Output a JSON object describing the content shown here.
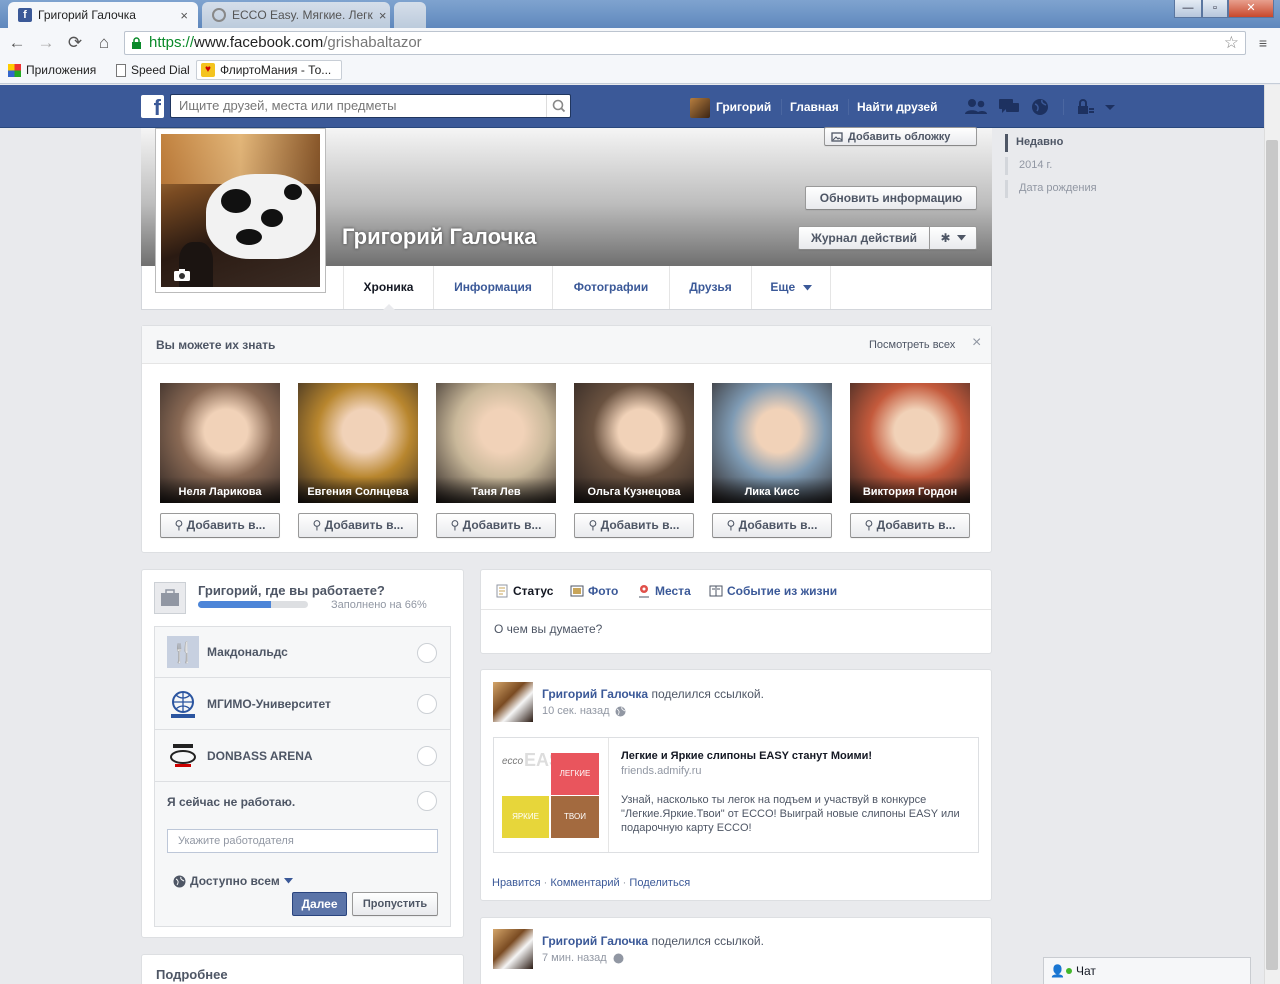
{
  "browser": {
    "tabs": [
      {
        "title": "Григорий Галочка",
        "close": "×"
      },
      {
        "title": "ECCO Easy. Мягкие. Легк",
        "close": "×"
      }
    ],
    "window_buttons": {
      "min": "—",
      "max": "▫",
      "close": "✕"
    },
    "url": {
      "scheme": "https://",
      "host": "www.facebook.com",
      "path": "/grishabaltazor"
    },
    "star": "☆",
    "bookmarks": [
      "Приложения",
      "Speed Dial",
      "ФлиртоМания - То..."
    ]
  },
  "fb": {
    "logo": "f",
    "search_placeholder": "Ищите друзей, места или предметы",
    "nav": {
      "user": "Григорий",
      "home": "Главная",
      "find": "Найти друзей"
    }
  },
  "profile": {
    "name": "Григорий Галочка",
    "add_cover": "Добавить обложку",
    "update_info": "Обновить информацию",
    "activity_log": "Журнал действий",
    "tabs": [
      "Хроника",
      "Информация",
      "Фотографии",
      "Друзья",
      "Еще"
    ]
  },
  "timeline_nav": {
    "recent": "Недавно",
    "year": "2014 г.",
    "birth": "Дата рождения"
  },
  "pymk": {
    "title": "Вы можете их знать",
    "see_all": "Посмотреть всех",
    "close": "×",
    "add_label": "Добавить в...",
    "people": [
      {
        "name": "Неля Ларикова",
        "color": "#8a6a55"
      },
      {
        "name": "Евгения Солнцева",
        "color": "#b8862e"
      },
      {
        "name": "Таня Лев",
        "color": "#c9b89a"
      },
      {
        "name": "Ольга Кузнецова",
        "color": "#6a5240"
      },
      {
        "name": "Лика Кисс",
        "color": "#7f9bb4"
      },
      {
        "name": "Виктория Гордон",
        "color": "#c45a3c"
      }
    ]
  },
  "work": {
    "question": "Григорий, где вы работаете?",
    "progress_text": "Заполнено на 66%",
    "progress": 0.66,
    "options": [
      "Макдональдс",
      "МГИМО-Университет",
      "DONBASS ARENA",
      "Я сейчас не работаю."
    ],
    "employer_placeholder": "Укажите работодателя",
    "privacy": "Доступно всем",
    "next": "Далее",
    "skip": "Пропустить"
  },
  "more": {
    "title": "Подробнее"
  },
  "composer": {
    "tabs": [
      "Статус",
      "Фото",
      "Места",
      "Событие из жизни"
    ],
    "placeholder": "О чем вы думаете?"
  },
  "post1": {
    "author": "Григорий Галочка",
    "action": "поделился ссылкой.",
    "time": "10 сек. назад",
    "link_title": "Легкие и Яркие слипоны EASY станут Моими!",
    "link_domain": "friends.admify.ru",
    "link_desc": "Узнай, насколько ты легок на подъем и участвуй в конкурсе \"Легкие.Яркие.Твои\" от ECCO! Выиграй новые слипоны EASY или подарочную карту ECCO!",
    "thumb": {
      "ecco": "ecco",
      "easy": "EASY",
      "light": "ЛЕГКИЕ",
      "bright": "ЯРКИЕ",
      "yours": "ТВОИ"
    },
    "like": "Нравится",
    "comment": "Комментарий",
    "share": "Поделиться"
  },
  "post2": {
    "author": "Григорий Галочка",
    "action": "поделился ссылкой.",
    "time": "7 мин. назад"
  },
  "chat": {
    "label": "Чат"
  }
}
